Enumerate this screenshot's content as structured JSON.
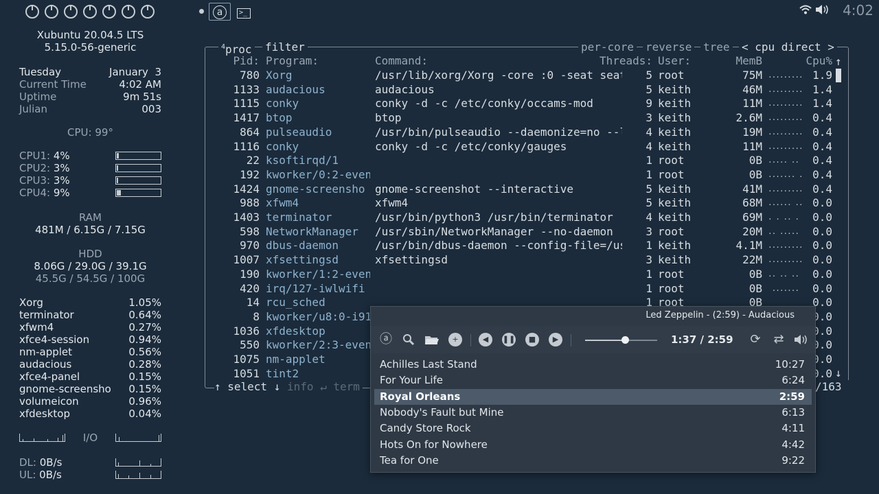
{
  "topbar": {
    "clock": "4:02",
    "workspace_count": 7,
    "icons": [
      "audacious-icon",
      "terminal-icon",
      "wifi-icon",
      "volume-icon"
    ]
  },
  "conky": {
    "os": "Xubuntu 20.04.5 LTS",
    "kernel": "5.15.0-56-generic",
    "day": "Tuesday",
    "date": "January  3",
    "time_label": "Current Time",
    "time_value": "4:02 AM",
    "uptime_label": "Uptime",
    "uptime_value": "9m 51s",
    "julian_label": "Julian",
    "julian_value": "003",
    "cpu_temp": "CPU: 99°",
    "cpus": [
      {
        "label": "CPU1:",
        "value": "4%",
        "pct": 4
      },
      {
        "label": "CPU2:",
        "value": "3%",
        "pct": 3
      },
      {
        "label": "CPU3:",
        "value": "3%",
        "pct": 3
      },
      {
        "label": "CPU4:",
        "value": "9%",
        "pct": 9
      }
    ],
    "ram_label": "RAM",
    "ram_value": "481M / 6.15G / 7.15G",
    "hdd_label": "HDD",
    "hdd_value1": "8.06G / 29.0G / 39.1G",
    "hdd_value2": "45.5G / 54.5G / 100G",
    "procs": [
      {
        "name": "Xorg",
        "pct": "1.05%"
      },
      {
        "name": "terminator",
        "pct": "0.64%"
      },
      {
        "name": "xfwm4",
        "pct": "0.27%"
      },
      {
        "name": "xfce4-session",
        "pct": "0.94%"
      },
      {
        "name": "nm-applet",
        "pct": "0.56%"
      },
      {
        "name": "audacious",
        "pct": "0.28%"
      },
      {
        "name": "xfce4-panel",
        "pct": "0.15%"
      },
      {
        "name": "gnome-screensho",
        "pct": "0.15%"
      },
      {
        "name": "volumeicon",
        "pct": "0.96%"
      },
      {
        "name": "xfdesktop",
        "pct": "0.04%"
      }
    ],
    "io_label": "I/O",
    "dl_label": "DL:",
    "dl_value": "0B/s",
    "ul_label": "UL:",
    "ul_value": "0B/s"
  },
  "btop": {
    "tab_num": "4",
    "tab_proc": "proc",
    "tab_filter": "filter",
    "per_core": "per-core",
    "reverse": "reverse",
    "tree": "tree",
    "sort": "< cpu direct >",
    "columns": {
      "pid": "Pid:",
      "program": "Program:",
      "command": "Command:",
      "threads": "Threads:",
      "user": "User:",
      "mem": "MemB",
      "cpu": "Cpu%"
    },
    "rows": [
      {
        "pid": "780",
        "program": "Xorg",
        "command": "/usr/lib/xorg/Xorg -core :0 -seat seat",
        "threads": "5",
        "user": "root",
        "mem": "75M",
        "spark": "..........",
        "cpu": "1.9"
      },
      {
        "pid": "1133",
        "program": "audacious",
        "command": "audacious",
        "threads": "5",
        "user": "keith",
        "mem": "46M",
        "spark": "..........",
        "cpu": "1.4"
      },
      {
        "pid": "1115",
        "program": "conky",
        "command": "conky -d -c /etc/conky/occams-mod",
        "threads": "9",
        "user": "keith",
        "mem": "11M",
        "spark": "..........",
        "cpu": "1.4"
      },
      {
        "pid": "1417",
        "program": "btop",
        "command": "btop",
        "threads": "3",
        "user": "keith",
        "mem": "2.6M",
        "spark": "..........",
        "cpu": "0.4"
      },
      {
        "pid": "864",
        "program": "pulseaudio",
        "command": "/usr/bin/pulseaudio --daemonize=no --l",
        "threads": "4",
        "user": "keith",
        "mem": "19M",
        "spark": "..........",
        "cpu": "0.4"
      },
      {
        "pid": "1116",
        "program": "conky",
        "command": "conky -d -c /etc/conky/gauges",
        "threads": "4",
        "user": "keith",
        "mem": "11M",
        "spark": "..........",
        "cpu": "0.4"
      },
      {
        "pid": "22",
        "program": "ksoftirqd/1",
        "command": "",
        "threads": "1",
        "user": "root",
        "mem": "0B",
        "spark": "..... ..",
        "cpu": "0.4"
      },
      {
        "pid": "192",
        "program": "kworker/0:2-even",
        "command": "",
        "threads": "1",
        "user": "root",
        "mem": "0B",
        "spark": "....... .",
        "cpu": "0.4"
      },
      {
        "pid": "1424",
        "program": "gnome-screensho",
        "command": "gnome-screenshot --interactive",
        "threads": "5",
        "user": "keith",
        "mem": "41M",
        "spark": "..........",
        "cpu": "0.4"
      },
      {
        "pid": "988",
        "program": "xfwm4",
        "command": "xfwm4",
        "threads": "5",
        "user": "keith",
        "mem": "68M",
        "spark": "...... ..",
        "cpu": "0.0"
      },
      {
        "pid": "1403",
        "program": "terminator",
        "command": "/usr/bin/python3 /usr/bin/terminator",
        "threads": "4",
        "user": "keith",
        "mem": "69M",
        "spark": ". . .. .",
        "cpu": "0.0"
      },
      {
        "pid": "598",
        "program": "NetworkManager",
        "command": "/usr/sbin/NetworkManager --no-daemon",
        "threads": "3",
        "user": "root",
        "mem": "20M",
        "spark": ".. .....",
        "cpu": "0.0"
      },
      {
        "pid": "970",
        "program": "dbus-daemon",
        "command": "/usr/bin/dbus-daemon --config-file=/us",
        "threads": "1",
        "user": "keith",
        "mem": "4.1M",
        "spark": ".........",
        "cpu": "0.0"
      },
      {
        "pid": "1007",
        "program": "xfsettingsd",
        "command": "xfsettingsd",
        "threads": "3",
        "user": "keith",
        "mem": "22M",
        "spark": ".........",
        "cpu": "0.0"
      },
      {
        "pid": "190",
        "program": "kworker/1:2-even",
        "command": "",
        "threads": "1",
        "user": "root",
        "mem": "0B",
        "spark": ".. .. ..",
        "cpu": "0.0"
      },
      {
        "pid": "420",
        "program": "irq/127-iwlwifi",
        "command": "",
        "threads": "1",
        "user": "root",
        "mem": "0B",
        "spark": " .......",
        "cpu": "0.0"
      },
      {
        "pid": "14",
        "program": "rcu_sched",
        "command": "",
        "threads": "1",
        "user": "root",
        "mem": "0B",
        "spark": "",
        "cpu": "0.0"
      },
      {
        "pid": "8",
        "program": "kworker/u8:0-i91",
        "command": "",
        "threads": "",
        "user": "",
        "mem": "",
        "spark": "",
        "cpu": "0.0"
      },
      {
        "pid": "1036",
        "program": "xfdesktop",
        "command": "",
        "threads": "",
        "user": "",
        "mem": "",
        "spark": "",
        "cpu": "0.0"
      },
      {
        "pid": "550",
        "program": "kworker/2:3-even",
        "command": "",
        "threads": "",
        "user": "",
        "mem": "",
        "spark": "",
        "cpu": "0.0"
      },
      {
        "pid": "1075",
        "program": "nm-applet",
        "command": "",
        "threads": "",
        "user": "",
        "mem": "",
        "spark": "",
        "cpu": "0.0"
      },
      {
        "pid": "1051",
        "program": "tint2",
        "command": "",
        "threads": "",
        "user": "",
        "mem": "",
        "spark": "",
        "cpu": "0.0"
      }
    ],
    "bottom_select": "↑ select ↓",
    "bottom_info": "info ↵",
    "bottom_term": "term",
    "scroll_up": "↑",
    "scroll_down": "↓",
    "count": "/163"
  },
  "audacious": {
    "title": "Led Zeppelin - (2:59) - Audacious",
    "time": "1:37 / 2:59",
    "progress": 0.55,
    "playlist": [
      {
        "name": "Achilles Last Stand",
        "length": "10:27",
        "selected": false
      },
      {
        "name": "For Your Life",
        "length": "6:24",
        "selected": false
      },
      {
        "name": "Royal Orleans",
        "length": "2:59",
        "selected": true
      },
      {
        "name": "Nobody's Fault but Mine",
        "length": "6:13",
        "selected": false
      },
      {
        "name": "Candy Store Rock",
        "length": "4:11",
        "selected": false
      },
      {
        "name": "Hots On for Nowhere",
        "length": "4:42",
        "selected": false
      },
      {
        "name": "Tea for One",
        "length": "9:22",
        "selected": false
      }
    ]
  }
}
